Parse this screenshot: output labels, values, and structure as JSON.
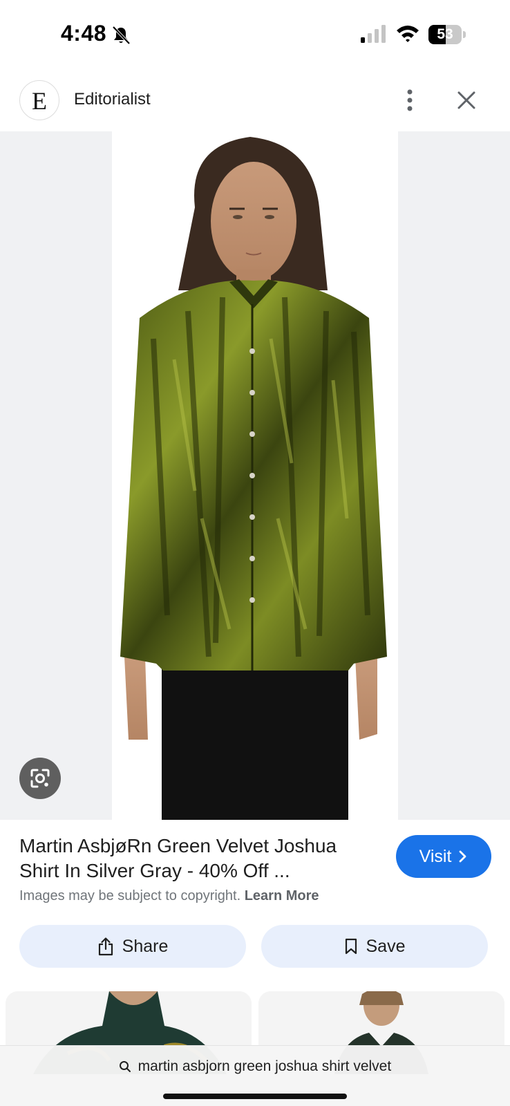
{
  "status_bar": {
    "time": "4:48",
    "battery": "53",
    "battery_level": 0.53
  },
  "header": {
    "logo_letter": "E",
    "source_name": "Editorialist"
  },
  "result": {
    "title": "Martin AsbjøRn Green Velvet Joshua Shirt In Silver Gray - 40% Off ...",
    "visit_label": "Visit",
    "copyright_text": "Images may be subject to copyright.",
    "learn_more": "Learn More"
  },
  "actions": {
    "share_label": "Share",
    "save_label": "Save"
  },
  "search": {
    "query": "martin asbjorn green joshua shirt velvet"
  },
  "colors": {
    "accent": "#1a73e8",
    "button_bg": "#e8effc",
    "shirt": "#6b7a1e"
  },
  "icons": [
    "bell-slash-icon",
    "signal-icon",
    "wifi-icon",
    "more-vert-icon",
    "close-icon",
    "lens-icon",
    "share-icon",
    "bookmark-icon",
    "search-icon",
    "chevron-right-icon"
  ]
}
